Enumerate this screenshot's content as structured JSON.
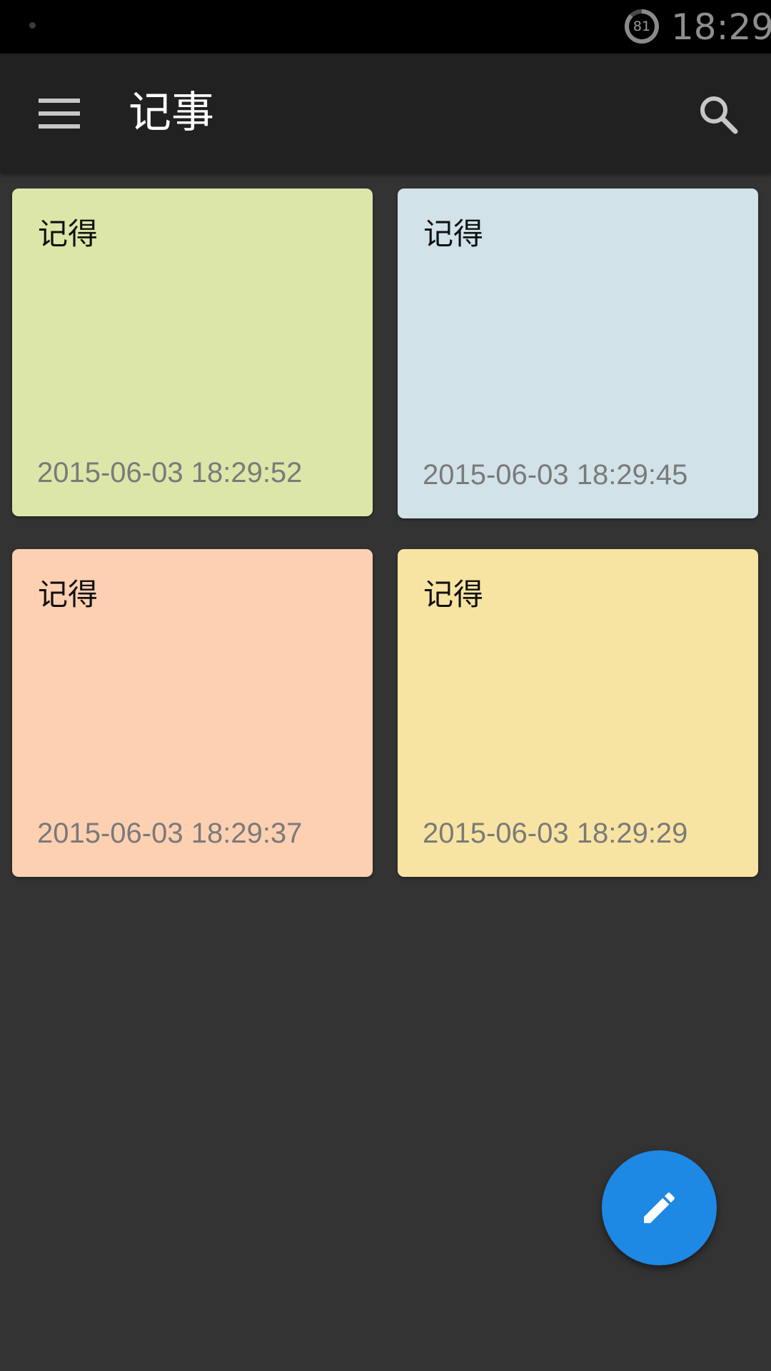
{
  "status_bar": {
    "battery_level": "81",
    "time": "18:29"
  },
  "app_bar": {
    "title": "记事",
    "menu_icon": "hamburger-menu-icon",
    "search_icon": "search-icon"
  },
  "notes": [
    {
      "title": "记得",
      "timestamp": "2015-06-03 18:29:52",
      "color": "#dce6a8"
    },
    {
      "title": "记得",
      "timestamp": "2015-06-03 18:29:45",
      "color": "#d1e3e8"
    },
    {
      "title": "记得",
      "timestamp": "2015-06-03 18:29:37",
      "color": "#fdd0b2"
    },
    {
      "title": "记得",
      "timestamp": "2015-06-03 18:29:29",
      "color": "#f8e4a2"
    }
  ],
  "fab": {
    "icon": "pencil-icon",
    "color": "#1e88e5"
  },
  "theme": {
    "background": "#333333",
    "app_bar": "#212121",
    "status_bar": "#000000"
  }
}
